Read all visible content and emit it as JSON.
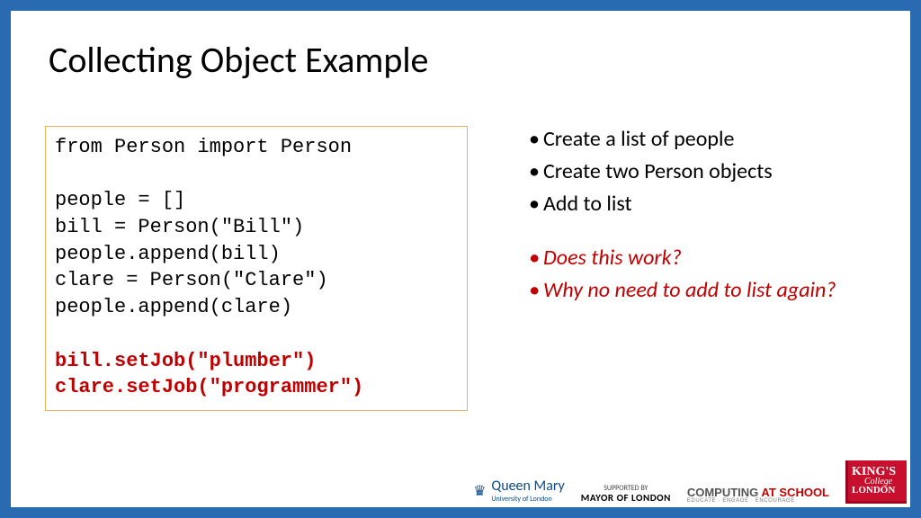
{
  "title": "Collecting Object Example",
  "code": {
    "l1": "from Person import Person",
    "l2": "people = []",
    "l3": "bill = Person(\"Bill\")",
    "l4": "people.append(bill)",
    "l5": "clare = Person(\"Clare\")",
    "l6": "people.append(clare)",
    "l7": "bill.setJob(\"plumber\")",
    "l8": "clare.setJob(\"programmer\")"
  },
  "bullets": {
    "b1": "Create a list of people",
    "b2": "Create two Person objects",
    "b3": "Add to list",
    "b4": "Does this work?",
    "b5": "Why no need to add to list again?"
  },
  "logos": {
    "qm_name": "Queen Mary",
    "qm_sub": "University of London",
    "mayor_sup": "SUPPORTED BY",
    "mayor_main": "MAYOR OF LONDON",
    "cas_a": "COMPUTING ",
    "cas_b": "AT SCHOOL",
    "cas_sub": "EDUCATE · ENGAGE · ENCOURAGE",
    "kcl_a": "KING'S",
    "kcl_b": "College",
    "kcl_c": "LONDON"
  }
}
